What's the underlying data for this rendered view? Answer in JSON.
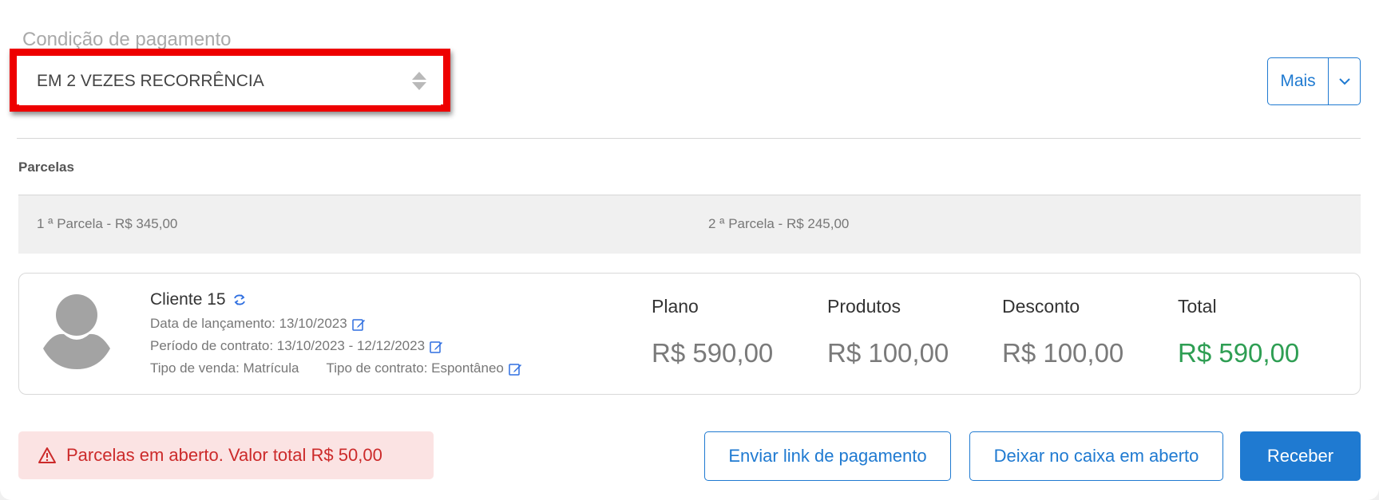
{
  "payment_condition": {
    "label": "Condição de pagamento",
    "selected_value": "EM 2 VEZES RECORRÊNCIA"
  },
  "more_menu": {
    "label": "Mais"
  },
  "installments": {
    "title": "Parcelas",
    "items": [
      {
        "label": "1 ª Parcela - R$ 345,00"
      },
      {
        "label": "2 ª Parcela - R$ 245,00"
      }
    ]
  },
  "client": {
    "name": "Cliente 15",
    "launch_date": "Data de lançamento: 13/10/2023",
    "contract_period": "Período de contrato: 13/10/2023 - 12/12/2023",
    "sale_type": "Tipo de venda: Matrícula",
    "contract_type": "Tipo de contrato: Espontâneo"
  },
  "summary": {
    "plan_label": "Plano",
    "plan_value": "R$ 590,00",
    "products_label": "Produtos",
    "products_value": "R$ 100,00",
    "discount_label": "Desconto",
    "discount_value": "R$ 100,00",
    "total_label": "Total",
    "total_value": "R$ 590,00"
  },
  "alert": {
    "text": "Parcelas em aberto. Valor total R$ 50,00"
  },
  "actions": {
    "send_link": "Enviar link de pagamento",
    "leave_open": "Deixar no caixa em aberto",
    "receive": "Receber"
  },
  "colors": {
    "primary": "#1f7ad1",
    "highlight": "#ee0000",
    "total_green": "#2e9e53",
    "alert_red": "#cc2a2a",
    "alert_bg": "#fbe3e3"
  },
  "icons": {
    "select": "sort-arrows-icon",
    "more_caret": "chevron-down-icon",
    "client_sync": "sync-icon",
    "edit": "edit-icon",
    "avatar": "user-avatar-icon",
    "alert": "warning-icon"
  }
}
